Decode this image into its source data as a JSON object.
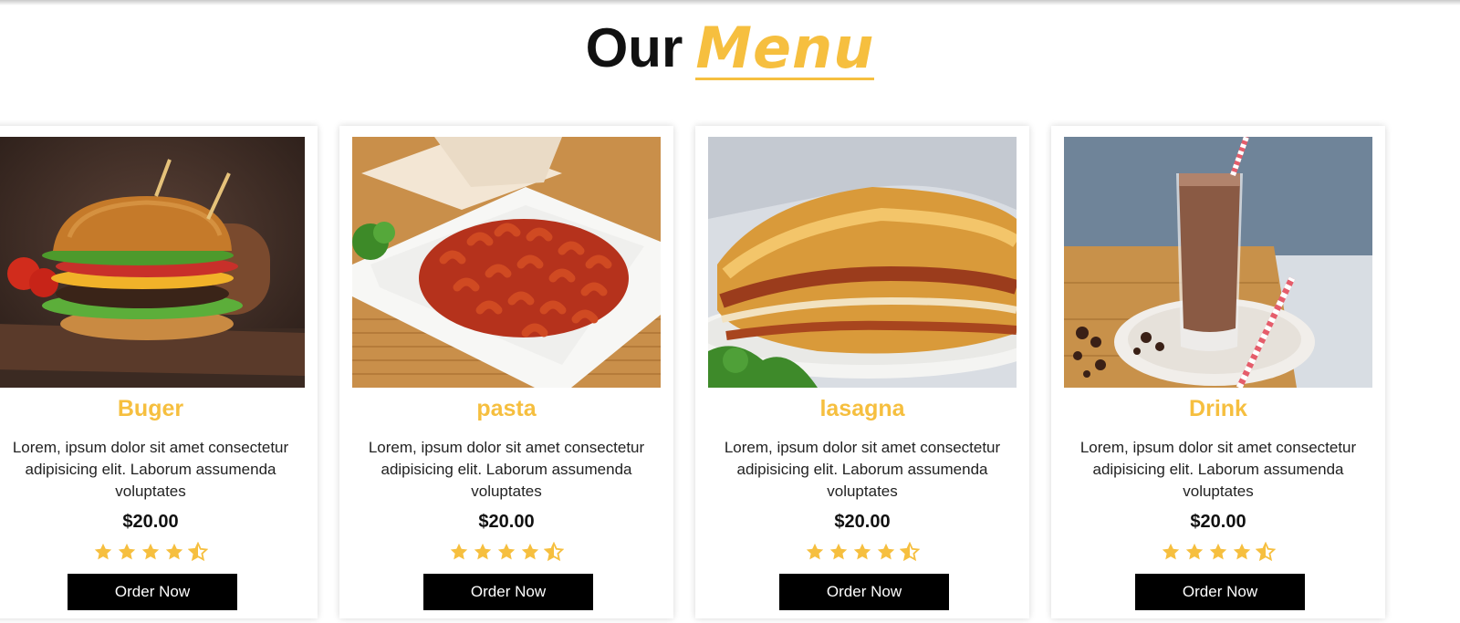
{
  "heading": {
    "main": "Our",
    "accent": "Menu"
  },
  "colors": {
    "accent": "#f6bf3f",
    "button": "#000000",
    "text": "#222222"
  },
  "cards": [
    {
      "title": "Buger",
      "description": "Lorem, ipsum dolor sit amet consectetur adipisicing elit. Laborum assumenda voluptates",
      "price": "$20.00",
      "rating": 4.5,
      "button": "Order Now",
      "image": "burger-photo"
    },
    {
      "title": "pasta",
      "description": "Lorem, ipsum dolor sit amet consectetur adipisicing elit. Laborum assumenda voluptates",
      "price": "$20.00",
      "rating": 4.5,
      "button": "Order Now",
      "image": "pasta-photo"
    },
    {
      "title": "lasagna",
      "description": "Lorem, ipsum dolor sit amet consectetur adipisicing elit. Laborum assumenda voluptates",
      "price": "$20.00",
      "rating": 4.5,
      "button": "Order Now",
      "image": "lasagna-photo"
    },
    {
      "title": "Drink",
      "description": "Lorem, ipsum dolor sit amet consectetur adipisicing elit. Laborum assumenda voluptates",
      "price": "$20.00",
      "rating": 4.5,
      "button": "Order Now",
      "image": "chocolate-drink-photo"
    }
  ]
}
